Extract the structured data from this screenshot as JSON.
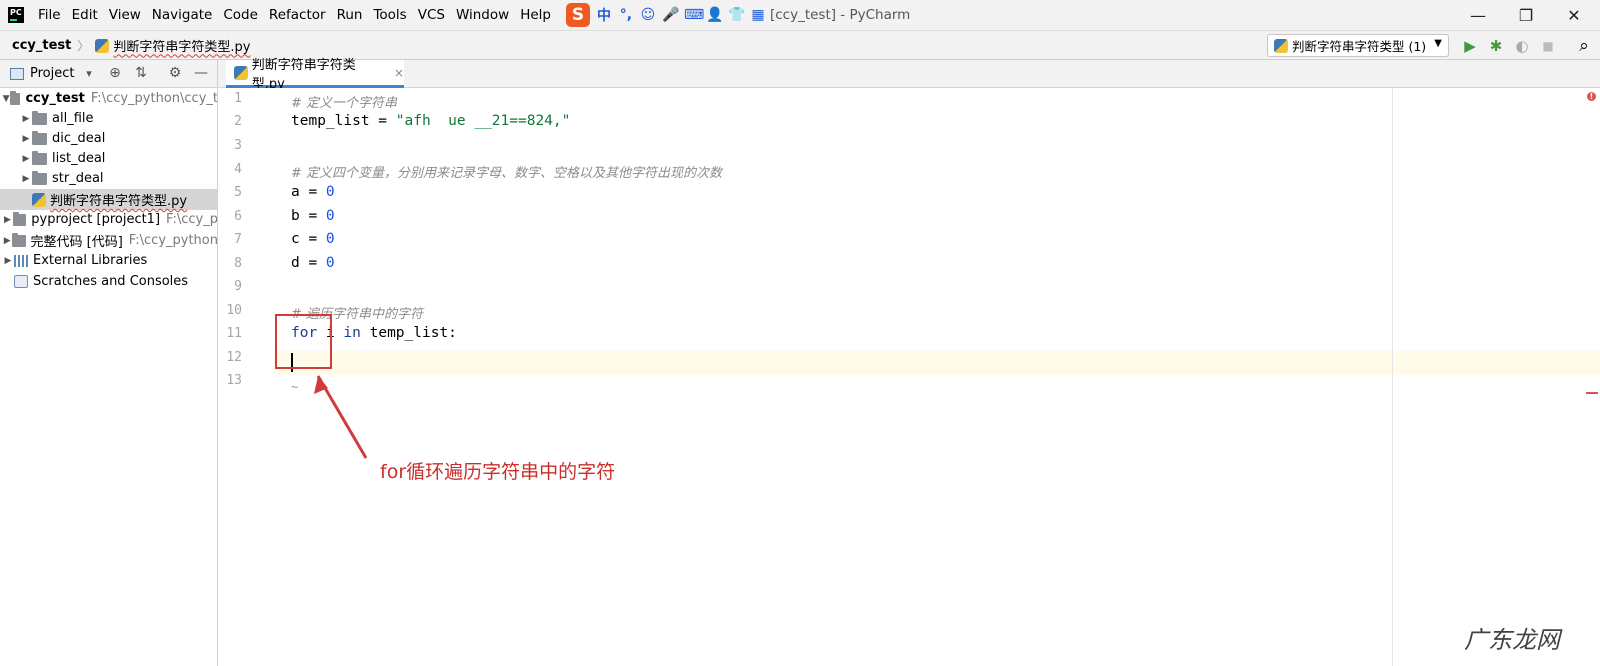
{
  "menubar": {
    "items": [
      "File",
      "Edit",
      "View",
      "Navigate",
      "Code",
      "Refactor",
      "Run",
      "Tools",
      "VCS",
      "Window",
      "Help"
    ],
    "ime": {
      "logo": "S",
      "mode": "中",
      "punct": "°,",
      "emoji": "☺",
      "mic": "🎤",
      "keyboard": "⌨",
      "person": "👤",
      "shirt": "👕",
      "grid": "▦"
    },
    "window_title": "[ccy_test] - PyCharm",
    "controls": {
      "minimize": "—",
      "restore": "❐",
      "close": "✕"
    }
  },
  "navbar": {
    "project": "ccy_test",
    "file": "判断字符串字符类型.py",
    "run_config": "判断字符串字符类型 (1)",
    "icons": {
      "run": "▶",
      "debug": "✱",
      "coverage": "◐",
      "stop": "■",
      "search": "⌕"
    }
  },
  "project_panel": {
    "title": "Project",
    "icons": {
      "dropdown": "▾",
      "locate": "⊕",
      "collapse": "⇅",
      "settings": "⚙",
      "hide": "—"
    },
    "tree": [
      {
        "arrow": "▼",
        "name": "ccy_test",
        "path": "F:\\ccy_python\\ccy_t",
        "bold": true,
        "indent": 0,
        "icon": "folder"
      },
      {
        "arrow": "▶",
        "name": "all_file",
        "path": "",
        "indent": 1,
        "icon": "folder"
      },
      {
        "arrow": "▶",
        "name": "dic_deal",
        "path": "",
        "indent": 1,
        "icon": "folder"
      },
      {
        "arrow": "▶",
        "name": "list_deal",
        "path": "",
        "indent": 1,
        "icon": "folder"
      },
      {
        "arrow": "▶",
        "name": "str_deal",
        "path": "",
        "indent": 1,
        "icon": "folder"
      },
      {
        "arrow": "",
        "name": "判断字符串字符类型.py",
        "path": "",
        "indent": 1,
        "icon": "python",
        "selected": true
      },
      {
        "arrow": "▶",
        "name": "pyproject [project1]",
        "path": "F:\\ccy_p",
        "indent": 0,
        "icon": "folder"
      },
      {
        "arrow": "▶",
        "name": "完整代码 [代码]",
        "path": "F:\\ccy_python",
        "indent": 0,
        "icon": "folder"
      },
      {
        "arrow": "▶",
        "name": "External Libraries",
        "path": "",
        "indent": 0,
        "icon": "library"
      },
      {
        "arrow": "",
        "name": "Scratches and Consoles",
        "path": "",
        "indent": 0,
        "icon": "scratch"
      }
    ]
  },
  "editor": {
    "tab": {
      "label": "判断字符串字符类型.py",
      "close": "×"
    },
    "line_numbers": [
      "1",
      "2",
      "3",
      "4",
      "5",
      "6",
      "7",
      "8",
      "9",
      "10",
      "11",
      "12",
      "13"
    ],
    "code": {
      "l1": "# 定义一个字符串",
      "l2_a": "temp_list = ",
      "l2_b": "\"afh  ue __21==824,\"",
      "l4": "# 定义四个变量，分别用来记录字母、数字、空格以及其他字符出现的次数",
      "l5_a": "a = ",
      "l5_b": "0",
      "l6_a": "b = ",
      "l6_b": "0",
      "l7_a": "c = ",
      "l7_b": "0",
      "l8_a": "d = ",
      "l8_b": "0",
      "l10": "# 遍历字符串中的字符",
      "l11_kw1": "for",
      "l11_a": " i ",
      "l11_kw2": "in",
      "l11_b": " temp_list:",
      "tilde": "~"
    },
    "error_icon": "!"
  },
  "annotation": {
    "text": "for循环遍历字符串中的字符",
    "color": "#c9302c"
  },
  "watermark": "广东龙网"
}
